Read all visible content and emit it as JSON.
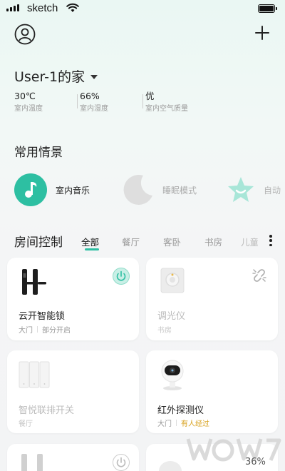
{
  "status_bar": {
    "carrier": "sketch"
  },
  "home": {
    "title": "User-1的家"
  },
  "stats": [
    {
      "value": "30℃",
      "label": "室内温度"
    },
    {
      "value": "66%",
      "label": "室内湿度"
    },
    {
      "value": "优",
      "label": "室内空气质量"
    }
  ],
  "scenes_section": {
    "title": "常用情景"
  },
  "scenes": [
    {
      "label": "室内音乐",
      "icon": "music-note-icon",
      "color": "#2dbfa2",
      "active": true
    },
    {
      "label": "睡眠模式",
      "icon": "moon-icon",
      "color": "#dedede",
      "active": false
    },
    {
      "label": "自动",
      "icon": "star-face-icon",
      "color": "#a8e6d8",
      "active": false
    }
  ],
  "rooms": {
    "title": "房间控制",
    "tabs": [
      "全部",
      "餐厅",
      "客卧",
      "书房",
      "儿童"
    ]
  },
  "devices": [
    {
      "name": "云开智能锁",
      "room": "大门",
      "status": "部分开启",
      "status_type": "normal",
      "icon": "smart-lock-icon",
      "state": "on",
      "action_icon": "power-icon"
    },
    {
      "name": "调光仪",
      "room": "书房",
      "status": "",
      "status_type": "normal",
      "icon": "dimmer-icon",
      "state": "off",
      "action_icon": "unlink-icon"
    },
    {
      "name": "智悦联排开关",
      "room": "餐厅",
      "status": "",
      "status_type": "normal",
      "icon": "switch-panel-icon",
      "state": "off",
      "action_icon": ""
    },
    {
      "name": "红外探测仪",
      "room": "大门",
      "status": "有人经过",
      "status_type": "warning",
      "icon": "camera-icon",
      "state": "on",
      "action_icon": ""
    }
  ],
  "bottom": {
    "percent": "36%"
  },
  "accent_color": "#2dbfa2",
  "warning_color": "#d8a21f"
}
